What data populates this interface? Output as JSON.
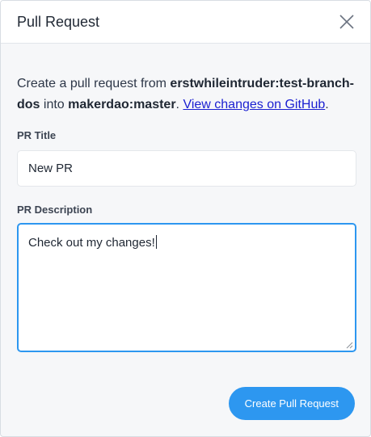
{
  "dialog": {
    "title": "Pull Request",
    "close_icon": "close-icon"
  },
  "intro": {
    "prefix": "Create a pull request from ",
    "source_branch": "erstwhileintruder:test-branch-dos",
    "middle": " into ",
    "target_branch": "makerdao:master",
    "suffix": ". ",
    "link_text": "View changes on GitHub",
    "end": "."
  },
  "form": {
    "title_label": "PR Title",
    "title_value": "New PR",
    "description_label": "PR Description",
    "description_value": "Check out my changes!"
  },
  "actions": {
    "submit_label": "Create Pull Request"
  },
  "colors": {
    "accent": "#2d97f0",
    "link": "#1a1fd1"
  }
}
